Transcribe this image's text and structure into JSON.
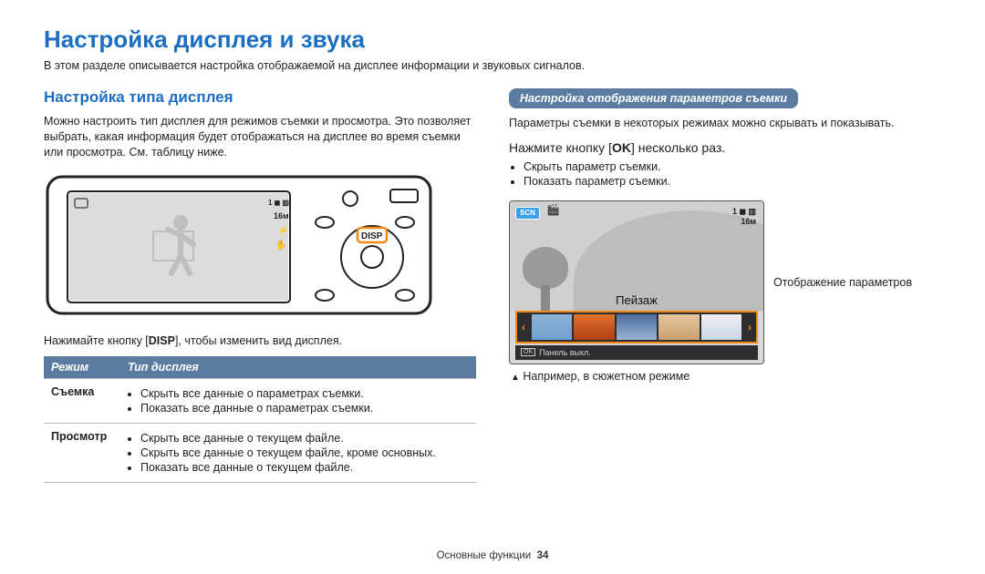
{
  "page": {
    "title": "Настройка дисплея и звука",
    "subtitle": "В этом разделе описывается настройка отображаемой на дисплее информации и звуковых сигналов."
  },
  "left": {
    "heading": "Настройка типа дисплея",
    "intro": "Можно настроить тип дисплея для режимов съемки и просмотра. Это позволяет выбрать, какая информация будет отображаться на дисплее во время съемки или просмотра. См. таблицу ниже.",
    "caption_pre": "Нажимайте кнопку [",
    "caption_btn": "DISP",
    "caption_post": "], чтобы изменить вид дисплея.",
    "camera_button": "DISP",
    "table": {
      "headers": {
        "mode": "Режим",
        "type": "Тип дисплея"
      },
      "row1": {
        "mode": "Съемка",
        "items": [
          "Скрыть все данные о параметрах съемки.",
          "Показать все данные о параметрах съемки."
        ]
      },
      "row2": {
        "mode": "Просмотр",
        "items": [
          "Скрыть все данные о текущем файле.",
          "Скрыть все данные о текущем файле, кроме основных.",
          "Показать все данные о текущем файле."
        ]
      }
    }
  },
  "right": {
    "pill": "Настройка отображения параметров съемки",
    "desc": "Параметры съемки в некоторых режимах можно скрывать и показывать.",
    "instr_pre": "Нажмите кнопку [",
    "instr_btn": "OK",
    "instr_post": "] несколько раз.",
    "bullets": [
      "Скрыть параметр съемки.",
      "Показать параметр съемки."
    ],
    "lcd": {
      "badge": "SCN",
      "top_right_1": "1 ◼ ▥",
      "top_right_2": "16м",
      "scene_label": "Пейзаж",
      "panel_off": "Панель выкл.",
      "ok": "OK"
    },
    "side_label": "Отображение параметров",
    "note": "Например, в сюжетном режиме"
  },
  "footer": {
    "section": "Основные функции",
    "page_no": "34"
  }
}
